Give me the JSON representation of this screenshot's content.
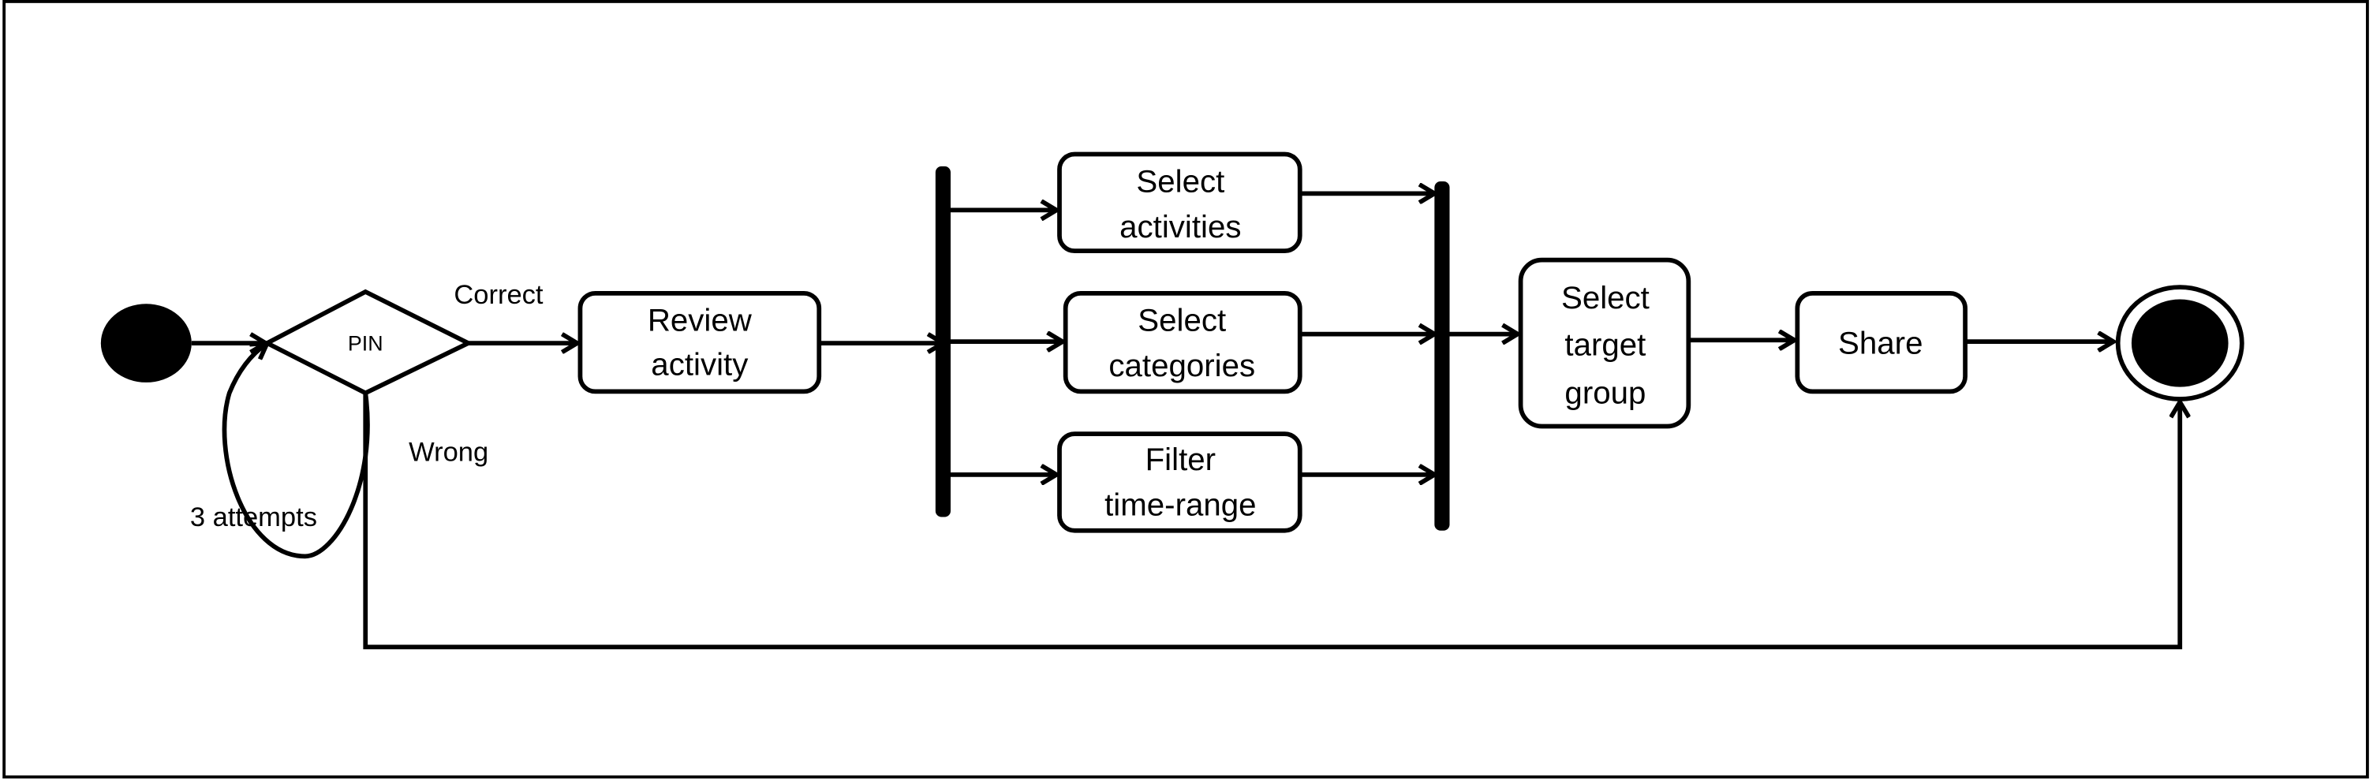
{
  "diagram": {
    "type": "UML activity diagram",
    "decision": {
      "label": "PIN"
    },
    "edge_labels": {
      "correct": "Correct",
      "wrong": "Wrong",
      "retry": "3 attempts"
    },
    "actions": {
      "review": [
        "Review",
        "activity"
      ],
      "select_activities": [
        "Select",
        "activities"
      ],
      "select_categories": [
        "Select",
        "categories"
      ],
      "filter_time": [
        "Filter",
        "time-range"
      ],
      "select_target": [
        "Select",
        "target",
        "group"
      ],
      "share": [
        "Share"
      ]
    },
    "colors": {
      "stroke": "#000000",
      "background": "#ffffff"
    }
  }
}
